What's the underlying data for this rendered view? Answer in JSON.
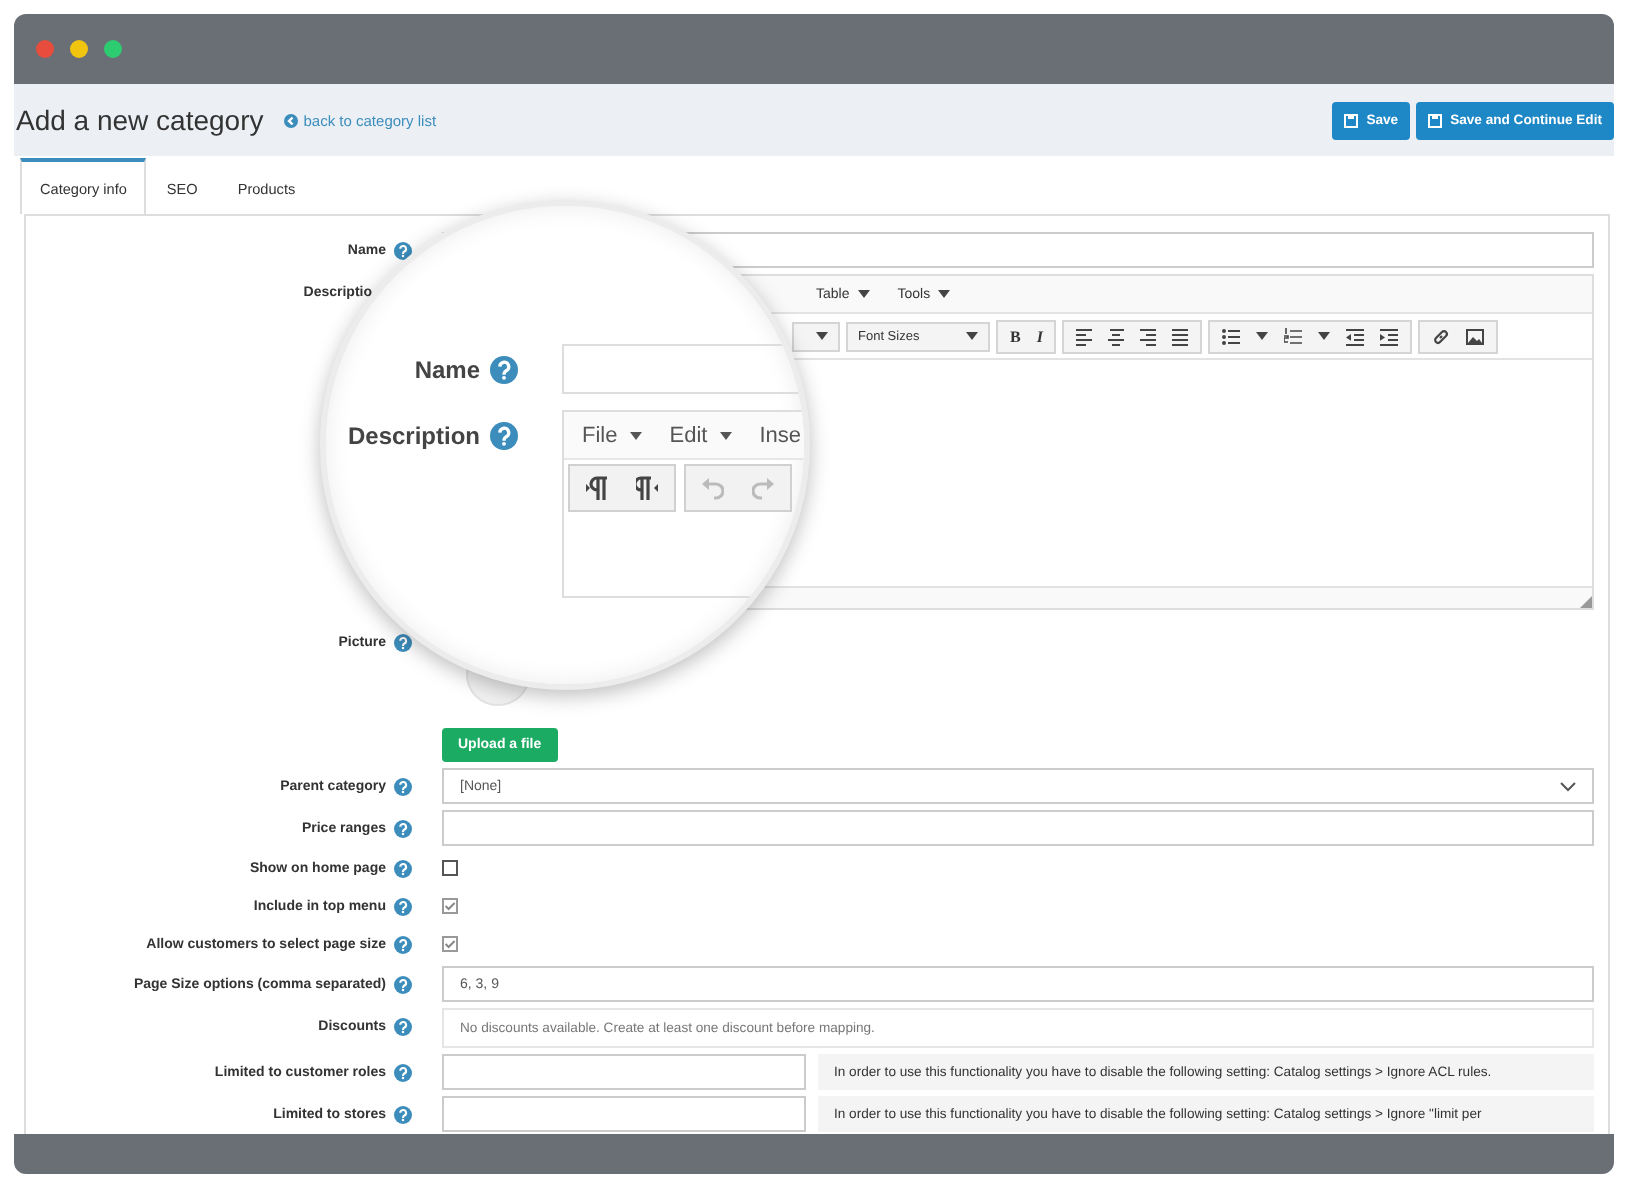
{
  "header": {
    "title": "Add a new category",
    "back_link": "back to category list",
    "buttons": [
      {
        "label": "Save"
      },
      {
        "label": "Save and Continue Edit"
      }
    ]
  },
  "tabs": [
    {
      "label": "Category info",
      "selected": true
    },
    {
      "label": "SEO",
      "selected": false
    },
    {
      "label": "Products",
      "selected": false
    }
  ],
  "fields": [
    {
      "kind": "text",
      "label": "Name"
    },
    {
      "kind": "editor",
      "label": "Descriptio",
      "menu": [
        "Table",
        "Tools"
      ],
      "font_size_select": "Font Sizes",
      "format_buttons": [
        "B",
        "I"
      ]
    },
    {
      "kind": "picture",
      "label": "Picture",
      "button": "Upload a file"
    },
    {
      "kind": "select",
      "label": "Parent category",
      "value": "[None]"
    },
    {
      "kind": "text",
      "label": "Price ranges"
    },
    {
      "kind": "checkbox",
      "label": "Show on home page",
      "checked": false
    },
    {
      "kind": "checkbox",
      "label": "Include in top menu",
      "checked": true
    },
    {
      "kind": "checkbox",
      "label": "Allow customers to select page size",
      "checked": true
    },
    {
      "kind": "text",
      "label": "Page Size options (comma separated)",
      "value": "6, 3, 9"
    },
    {
      "kind": "note",
      "label": "Discounts",
      "text": "No discounts available. Create at least one discount before mapping."
    },
    {
      "kind": "restricted",
      "label": "Limited to customer roles",
      "note": "In order to use this functionality you have to disable the following setting: Catalog settings > Ignore ACL rules."
    },
    {
      "kind": "restricted",
      "label": "Limited to stores",
      "note": "In order to use this functionality you have to disable the following setting: Catalog settings > Ignore \"limit per"
    }
  ],
  "magnifier": {
    "name_label": "Name",
    "description_label": "Description",
    "menu": [
      "File",
      "Edit",
      "Inse"
    ]
  }
}
